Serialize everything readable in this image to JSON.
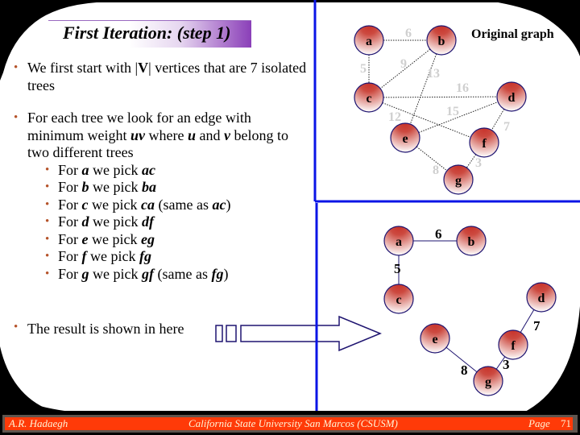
{
  "slide": {
    "title": "First Iteration: (step 1)",
    "bullets": [
      {
        "level": 1,
        "parts": [
          {
            "t": "We first start with |"
          },
          {
            "t": "V",
            "style": "b"
          },
          {
            "t": "| vertices that are 7 isolated trees"
          }
        ]
      },
      {
        "level": 1,
        "parts": [
          {
            "t": "For each tree we look for an edge with minimum weight "
          },
          {
            "t": "uv",
            "style": "bi"
          },
          {
            "t": " where "
          },
          {
            "t": "u",
            "style": "bi"
          },
          {
            "t": " and "
          },
          {
            "t": "v",
            "style": "bi"
          },
          {
            "t": " belong to two different trees"
          }
        ]
      },
      {
        "level": 2,
        "parts": [
          {
            "t": "For "
          },
          {
            "t": "a",
            "style": "bi"
          },
          {
            "t": " we pick "
          },
          {
            "t": "ac",
            "style": "bi"
          }
        ]
      },
      {
        "level": 2,
        "parts": [
          {
            "t": "For "
          },
          {
            "t": "b",
            "style": "bi"
          },
          {
            "t": " we pick "
          },
          {
            "t": "ba",
            "style": "bi"
          }
        ]
      },
      {
        "level": 2,
        "parts": [
          {
            "t": "For "
          },
          {
            "t": "c",
            "style": "bi"
          },
          {
            "t": " we pick "
          },
          {
            "t": "ca",
            "style": "bi"
          },
          {
            "t": " (same as "
          },
          {
            "t": "ac",
            "style": "bi"
          },
          {
            "t": ")"
          }
        ]
      },
      {
        "level": 2,
        "parts": [
          {
            "t": "For "
          },
          {
            "t": "d",
            "style": "bi"
          },
          {
            "t": " we pick "
          },
          {
            "t": "df",
            "style": "bi"
          }
        ]
      },
      {
        "level": 2,
        "parts": [
          {
            "t": "For "
          },
          {
            "t": "e",
            "style": "bi"
          },
          {
            "t": " we pick "
          },
          {
            "t": "eg",
            "style": "bi"
          }
        ]
      },
      {
        "level": 2,
        "parts": [
          {
            "t": "For "
          },
          {
            "t": "f",
            "style": "bi"
          },
          {
            "t": " we pick "
          },
          {
            "t": "fg",
            "style": "bi"
          }
        ]
      },
      {
        "level": 2,
        "parts": [
          {
            "t": "For "
          },
          {
            "t": "g",
            "style": "bi"
          },
          {
            "t": " we pick "
          },
          {
            "t": "gf",
            "style": "bi"
          },
          {
            "t": " (same as "
          },
          {
            "t": "fg",
            "style": "bi"
          },
          {
            "t": ")"
          }
        ]
      }
    ],
    "result_text": "The result is shown in here"
  },
  "original_graph": {
    "label": "Original graph",
    "nodes": [
      "a",
      "b",
      "c",
      "d",
      "e",
      "f",
      "g"
    ],
    "edges": [
      {
        "from": "a",
        "to": "b",
        "weight": "6"
      },
      {
        "from": "a",
        "to": "c",
        "weight": "5"
      },
      {
        "from": "b",
        "to": "c",
        "weight": "9"
      },
      {
        "from": "b",
        "to": "e",
        "weight": "13"
      },
      {
        "from": "c",
        "to": "d",
        "weight": "16"
      },
      {
        "from": "c",
        "to": "f",
        "weight": "12"
      },
      {
        "from": "e",
        "to": "d",
        "weight": "15"
      },
      {
        "from": "d",
        "to": "f",
        "weight": "7"
      },
      {
        "from": "e",
        "to": "g",
        "weight": "8"
      },
      {
        "from": "f",
        "to": "g",
        "weight": "3"
      }
    ]
  },
  "result_graph": {
    "nodes": [
      "a",
      "b",
      "c",
      "d",
      "e",
      "f",
      "g"
    ],
    "edges": [
      {
        "from": "a",
        "to": "b",
        "weight": "6"
      },
      {
        "from": "a",
        "to": "c",
        "weight": "5"
      },
      {
        "from": "d",
        "to": "f",
        "weight": "7"
      },
      {
        "from": "e",
        "to": "g",
        "weight": "8"
      },
      {
        "from": "f",
        "to": "g",
        "weight": "3"
      }
    ]
  },
  "colors": {
    "divider": "#0a14e6",
    "node_top": "#c8322a",
    "node_bottom": "#ffffff",
    "node_stroke": "#1e1470",
    "weight_faded": "#cfcfcf",
    "footer_bg": "#ff3a08",
    "footer_text": "#fff3d6",
    "bullet": "#b5532a"
  },
  "footer": {
    "author": "A.R. Hadaegh",
    "institution": "California State University San Marcos (CSUSM)",
    "page_label": "Page",
    "page_number": "71"
  }
}
